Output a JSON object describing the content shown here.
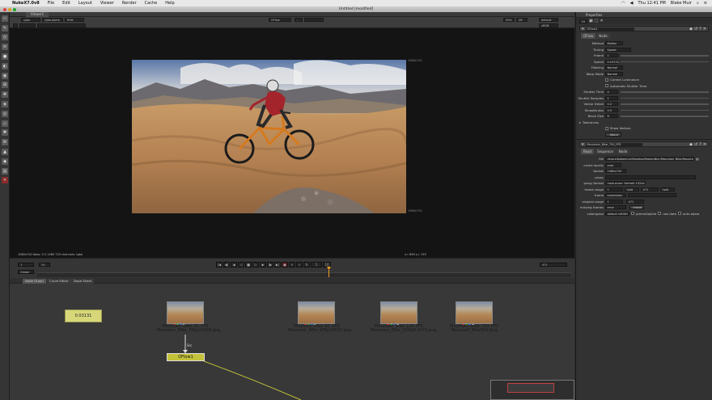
{
  "menubar": {
    "items": [
      "NukeX7.0v8",
      "File",
      "Edit",
      "Layout",
      "Viewer",
      "Render",
      "Cache",
      "Help"
    ],
    "clock": "Thu 12:41 PM",
    "user": "Blake Muir"
  },
  "window": {
    "title": "Untitled [modified]"
  },
  "viewer": {
    "tab": "Viewer1",
    "channels": "rgba",
    "alpha": "rgba.alpha",
    "colorspace": "RGB",
    "input_a": "OFlow",
    "input_b": "-",
    "zoom": "50%",
    "gain": "f/8",
    "lut": "default",
    "display": "sRGB",
    "frame_label": "1080x720",
    "status": "1080x720 bbox: 0 0 1080 720 channels: rgba",
    "cursor": "x= 690 y= 155",
    "colors": {
      "frame_label": "#888888"
    }
  },
  "timeline": {
    "range_start": "1",
    "range_end": "471",
    "fps": "24",
    "mode": "Global",
    "current_frame": "1",
    "step": "10"
  },
  "nodegraph": {
    "tabs": [
      "Node Graph",
      "Curve Editor",
      "Dope Sheet"
    ],
    "backdrop_label": "0.03131",
    "oflow_label": "OFlow1",
    "src_label": "Src",
    "read_nodes": [
      {
        "line1": "Mountain_Bike_25_FPS",
        "line2": "Mountain_Bike_25fps.0028.png"
      },
      {
        "line1": "Mountain_Bike_60_FPS",
        "line2": "Mountain_Bike_60fps.0037.png"
      },
      {
        "line1": "Mountain_Bike_120_FPS",
        "line2": "Mountain_Bike_120fps.0073.png"
      },
      {
        "line1": "Mountain_Bike_750_FPS",
        "line2": "Mountain_Bike309.png"
      }
    ]
  },
  "properties": {
    "title": "Properties",
    "count": "10",
    "oflow": {
      "name": "OFlow1",
      "tabs": [
        "OFlow",
        "Node"
      ],
      "method_label": "Method",
      "method": "Motion",
      "timing_label": "Timing",
      "timing": "Speed",
      "frame_label": "Frame",
      "frame": "1",
      "speed_label": "Speed",
      "speed": "0.03131",
      "filtering_label": "Filtering",
      "filtering": "Normal",
      "warp_label": "Warp Mode",
      "warp": "Normal",
      "correct_lum": "Correct Luminance",
      "auto_shutter": "Automatic Shutter Time",
      "shutter_time_label": "Shutter Time",
      "shutter_time": "0",
      "shutter_samples_label": "Shutter Samples",
      "shutter_samples": "1",
      "vector_detail_label": "Vector Detail",
      "vector_detail": "0.2",
      "smoothness_label": "Smoothness",
      "smoothness": "0.5",
      "block_size_label": "Block Size",
      "block_size": "6",
      "tolerances": "Tolerances",
      "show_vectors": "Show Vectors",
      "about": "About"
    },
    "read": {
      "name": "Mountain_Bike_750_FPS",
      "tabs": [
        "Read",
        "Sequence",
        "Node"
      ],
      "file_label": "file",
      "file": "/Users/blakemuir/Desktop/MotionBlur/Mountain_Bike/Mountain_Bike###.png",
      "cache_label": "cache locally",
      "cache": "auto",
      "format_label": "format",
      "format": "1080x720",
      "proxy_label": "proxy",
      "proxy": "",
      "proxy_format_label": "proxy format",
      "proxy_format": "(root.proxy_format) 1024x778",
      "frame_range_label": "frame range",
      "range_start": "1",
      "range_start_mode": "hold",
      "range_end": "471",
      "range_end_mode": "hold",
      "frame_label": "frame",
      "frame_mode": "expression",
      "original_range_label": "original range",
      "orig_start": "1",
      "orig_end": "471",
      "missing_frames_label": "missing frames",
      "missing_frames": "error",
      "reload": "reload",
      "colorspace_label": "colorspace",
      "colorspace": "default (sRGB)",
      "premultiplied": "premultiplied",
      "raw_data": "raw data",
      "auto_alpha": "auto alpha"
    }
  }
}
